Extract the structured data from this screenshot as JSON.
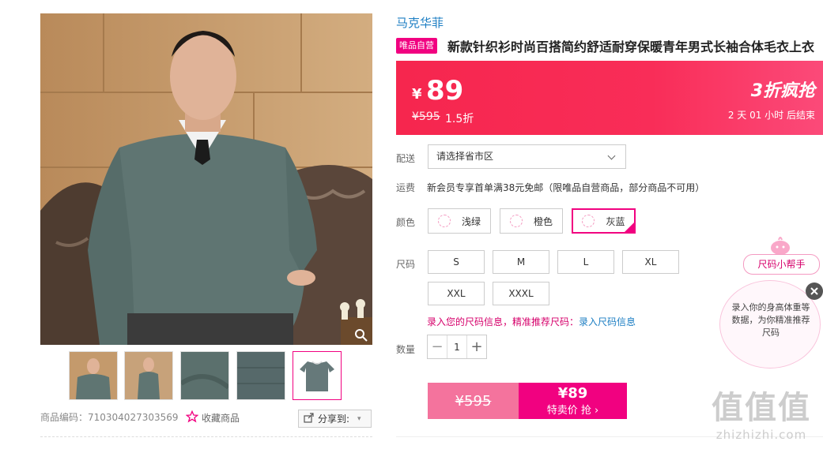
{
  "brand": "马克华菲",
  "vip_tag": "唯品自营",
  "title": "新款针织衫时尚百搭简约舒适耐穿保暖青年男式长袖合体毛衣上衣",
  "price": {
    "currency": "¥",
    "current": "89",
    "original": "¥595",
    "discount": "1.5折",
    "promo": "3折疯抢",
    "countdown": "2  天 01 小时 后结束"
  },
  "delivery": {
    "label": "配送",
    "select_value": "请选择省市区"
  },
  "shipping": {
    "label": "运费",
    "text": "新会员专享首单满38元免邮（限唯品自营商品，部分商品不可用）"
  },
  "colors": {
    "label": "颜色",
    "options": [
      "浅绿",
      "橙色",
      "灰蓝"
    ],
    "selected": "灰蓝"
  },
  "sizes": {
    "label": "尺码",
    "options": [
      "S",
      "M",
      "L",
      "XL",
      "XXL",
      "XXXL"
    ]
  },
  "size_tip": {
    "pink": "录入您的尺码信息，精准推荐尺码：",
    "link": "录入尺码信息"
  },
  "quantity": {
    "label": "数量",
    "value": "1",
    "minus": "−",
    "plus": "+"
  },
  "buy": {
    "original": "¥595",
    "price": "¥89",
    "label": "特卖价 抢 ›"
  },
  "product_code": "商品编码：710304027303569",
  "favorite": "收藏商品",
  "share": "分享到:",
  "size_helper": {
    "tag": "尺码小帮手",
    "text": "录入你的身高体重等数据，为你精准推荐尺码"
  },
  "watermark": {
    "main": "值值值",
    "site": "zhizhizhi.com"
  },
  "colors_theme": {
    "accent": "#f10180",
    "banner": "#f92d58",
    "link": "#1c7ec3"
  }
}
